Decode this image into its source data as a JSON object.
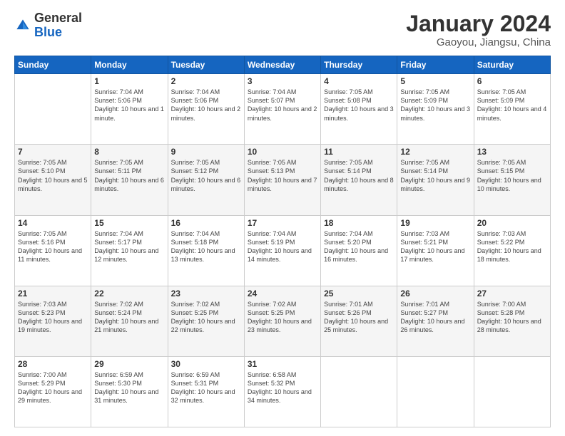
{
  "header": {
    "logo": {
      "general": "General",
      "blue": "Blue"
    },
    "title": "January 2024",
    "subtitle": "Gaoyou, Jiangsu, China"
  },
  "weekdays": [
    "Sunday",
    "Monday",
    "Tuesday",
    "Wednesday",
    "Thursday",
    "Friday",
    "Saturday"
  ],
  "weeks": [
    [
      {
        "day": "",
        "sunrise": "",
        "sunset": "",
        "daylight": ""
      },
      {
        "day": "1",
        "sunrise": "Sunrise: 7:04 AM",
        "sunset": "Sunset: 5:06 PM",
        "daylight": "Daylight: 10 hours and 1 minute."
      },
      {
        "day": "2",
        "sunrise": "Sunrise: 7:04 AM",
        "sunset": "Sunset: 5:06 PM",
        "daylight": "Daylight: 10 hours and 2 minutes."
      },
      {
        "day": "3",
        "sunrise": "Sunrise: 7:04 AM",
        "sunset": "Sunset: 5:07 PM",
        "daylight": "Daylight: 10 hours and 2 minutes."
      },
      {
        "day": "4",
        "sunrise": "Sunrise: 7:05 AM",
        "sunset": "Sunset: 5:08 PM",
        "daylight": "Daylight: 10 hours and 3 minutes."
      },
      {
        "day": "5",
        "sunrise": "Sunrise: 7:05 AM",
        "sunset": "Sunset: 5:09 PM",
        "daylight": "Daylight: 10 hours and 3 minutes."
      },
      {
        "day": "6",
        "sunrise": "Sunrise: 7:05 AM",
        "sunset": "Sunset: 5:09 PM",
        "daylight": "Daylight: 10 hours and 4 minutes."
      }
    ],
    [
      {
        "day": "7",
        "sunrise": "Sunrise: 7:05 AM",
        "sunset": "Sunset: 5:10 PM",
        "daylight": "Daylight: 10 hours and 5 minutes."
      },
      {
        "day": "8",
        "sunrise": "Sunrise: 7:05 AM",
        "sunset": "Sunset: 5:11 PM",
        "daylight": "Daylight: 10 hours and 6 minutes."
      },
      {
        "day": "9",
        "sunrise": "Sunrise: 7:05 AM",
        "sunset": "Sunset: 5:12 PM",
        "daylight": "Daylight: 10 hours and 6 minutes."
      },
      {
        "day": "10",
        "sunrise": "Sunrise: 7:05 AM",
        "sunset": "Sunset: 5:13 PM",
        "daylight": "Daylight: 10 hours and 7 minutes."
      },
      {
        "day": "11",
        "sunrise": "Sunrise: 7:05 AM",
        "sunset": "Sunset: 5:14 PM",
        "daylight": "Daylight: 10 hours and 8 minutes."
      },
      {
        "day": "12",
        "sunrise": "Sunrise: 7:05 AM",
        "sunset": "Sunset: 5:14 PM",
        "daylight": "Daylight: 10 hours and 9 minutes."
      },
      {
        "day": "13",
        "sunrise": "Sunrise: 7:05 AM",
        "sunset": "Sunset: 5:15 PM",
        "daylight": "Daylight: 10 hours and 10 minutes."
      }
    ],
    [
      {
        "day": "14",
        "sunrise": "Sunrise: 7:05 AM",
        "sunset": "Sunset: 5:16 PM",
        "daylight": "Daylight: 10 hours and 11 minutes."
      },
      {
        "day": "15",
        "sunrise": "Sunrise: 7:04 AM",
        "sunset": "Sunset: 5:17 PM",
        "daylight": "Daylight: 10 hours and 12 minutes."
      },
      {
        "day": "16",
        "sunrise": "Sunrise: 7:04 AM",
        "sunset": "Sunset: 5:18 PM",
        "daylight": "Daylight: 10 hours and 13 minutes."
      },
      {
        "day": "17",
        "sunrise": "Sunrise: 7:04 AM",
        "sunset": "Sunset: 5:19 PM",
        "daylight": "Daylight: 10 hours and 14 minutes."
      },
      {
        "day": "18",
        "sunrise": "Sunrise: 7:04 AM",
        "sunset": "Sunset: 5:20 PM",
        "daylight": "Daylight: 10 hours and 16 minutes."
      },
      {
        "day": "19",
        "sunrise": "Sunrise: 7:03 AM",
        "sunset": "Sunset: 5:21 PM",
        "daylight": "Daylight: 10 hours and 17 minutes."
      },
      {
        "day": "20",
        "sunrise": "Sunrise: 7:03 AM",
        "sunset": "Sunset: 5:22 PM",
        "daylight": "Daylight: 10 hours and 18 minutes."
      }
    ],
    [
      {
        "day": "21",
        "sunrise": "Sunrise: 7:03 AM",
        "sunset": "Sunset: 5:23 PM",
        "daylight": "Daylight: 10 hours and 19 minutes."
      },
      {
        "day": "22",
        "sunrise": "Sunrise: 7:02 AM",
        "sunset": "Sunset: 5:24 PM",
        "daylight": "Daylight: 10 hours and 21 minutes."
      },
      {
        "day": "23",
        "sunrise": "Sunrise: 7:02 AM",
        "sunset": "Sunset: 5:25 PM",
        "daylight": "Daylight: 10 hours and 22 minutes."
      },
      {
        "day": "24",
        "sunrise": "Sunrise: 7:02 AM",
        "sunset": "Sunset: 5:25 PM",
        "daylight": "Daylight: 10 hours and 23 minutes."
      },
      {
        "day": "25",
        "sunrise": "Sunrise: 7:01 AM",
        "sunset": "Sunset: 5:26 PM",
        "daylight": "Daylight: 10 hours and 25 minutes."
      },
      {
        "day": "26",
        "sunrise": "Sunrise: 7:01 AM",
        "sunset": "Sunset: 5:27 PM",
        "daylight": "Daylight: 10 hours and 26 minutes."
      },
      {
        "day": "27",
        "sunrise": "Sunrise: 7:00 AM",
        "sunset": "Sunset: 5:28 PM",
        "daylight": "Daylight: 10 hours and 28 minutes."
      }
    ],
    [
      {
        "day": "28",
        "sunrise": "Sunrise: 7:00 AM",
        "sunset": "Sunset: 5:29 PM",
        "daylight": "Daylight: 10 hours and 29 minutes."
      },
      {
        "day": "29",
        "sunrise": "Sunrise: 6:59 AM",
        "sunset": "Sunset: 5:30 PM",
        "daylight": "Daylight: 10 hours and 31 minutes."
      },
      {
        "day": "30",
        "sunrise": "Sunrise: 6:59 AM",
        "sunset": "Sunset: 5:31 PM",
        "daylight": "Daylight: 10 hours and 32 minutes."
      },
      {
        "day": "31",
        "sunrise": "Sunrise: 6:58 AM",
        "sunset": "Sunset: 5:32 PM",
        "daylight": "Daylight: 10 hours and 34 minutes."
      },
      {
        "day": "",
        "sunrise": "",
        "sunset": "",
        "daylight": ""
      },
      {
        "day": "",
        "sunrise": "",
        "sunset": "",
        "daylight": ""
      },
      {
        "day": "",
        "sunrise": "",
        "sunset": "",
        "daylight": ""
      }
    ]
  ]
}
